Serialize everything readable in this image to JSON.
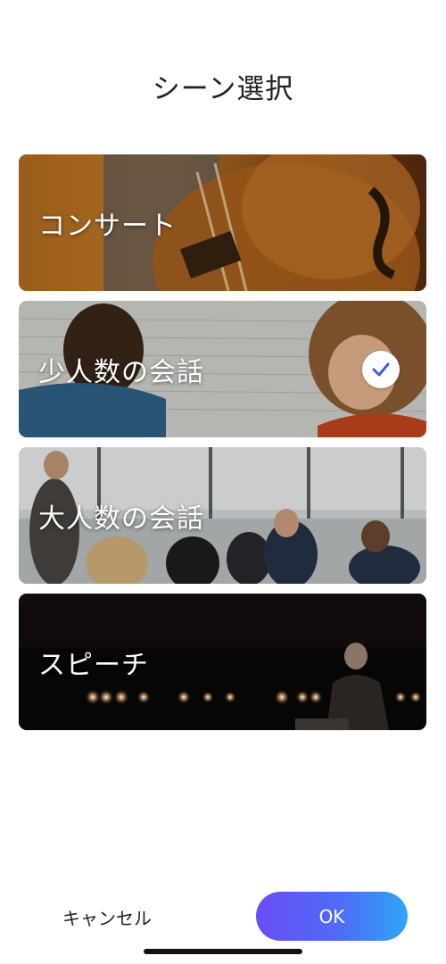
{
  "header": {
    "title": "シーン選択"
  },
  "scenes": [
    {
      "label": "コンサート",
      "selected": false,
      "image": "cello-concert-photo"
    },
    {
      "label": "少人数の会話",
      "selected": true,
      "image": "two-people-conversation-photo"
    },
    {
      "label": "大人数の会話",
      "selected": false,
      "image": "group-meeting-photo"
    },
    {
      "label": "スピーチ",
      "selected": false,
      "image": "stage-speech-photo"
    }
  ],
  "footer": {
    "cancel_label": "キャンセル",
    "ok_label": "OK"
  },
  "colors": {
    "ok_gradient_start": "#6a4df5",
    "ok_gradient_end": "#2ea6f7",
    "check_color": "#3b5ee8"
  }
}
